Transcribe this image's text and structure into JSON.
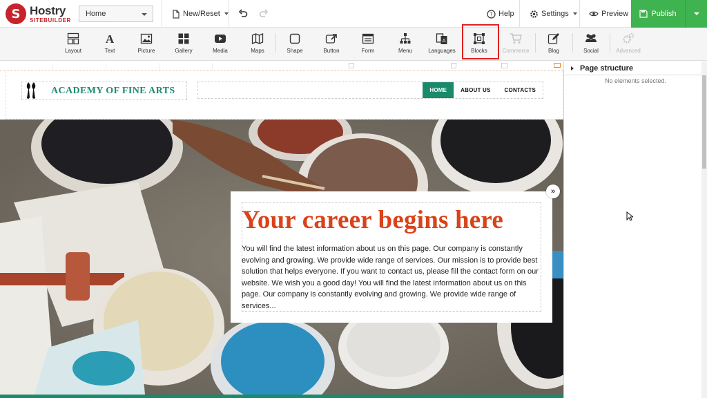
{
  "app": {
    "logo_main": "Hostry",
    "logo_sub": "SITEBUILDER",
    "page_select": "Home",
    "new_reset": "New/Reset",
    "help": "Help",
    "settings": "Settings",
    "preview": "Preview",
    "publish": "Publish"
  },
  "toolbar": {
    "tools": [
      {
        "label": "Layout",
        "icon": "layout-icon"
      },
      {
        "label": "Text",
        "icon": "text-icon"
      },
      {
        "label": "Picture",
        "icon": "picture-icon"
      },
      {
        "label": "Gallery",
        "icon": "gallery-icon"
      },
      {
        "label": "Media",
        "icon": "media-icon"
      },
      {
        "label": "Maps",
        "icon": "maps-icon"
      },
      {
        "label": "Shape",
        "icon": "shape-icon"
      },
      {
        "label": "Button",
        "icon": "button-icon"
      },
      {
        "label": "Form",
        "icon": "form-icon"
      },
      {
        "label": "Menu",
        "icon": "menu-icon"
      },
      {
        "label": "Languages",
        "icon": "languages-icon"
      },
      {
        "label": "Blocks",
        "icon": "blocks-icon",
        "highlighted": true
      },
      {
        "label": "Commerce",
        "icon": "commerce-icon",
        "disabled": true
      },
      {
        "label": "Blog",
        "icon": "blog-icon"
      },
      {
        "label": "Social",
        "icon": "social-icon"
      },
      {
        "label": "Advanced",
        "icon": "advanced-icon",
        "disabled": true
      }
    ]
  },
  "site": {
    "brand": "ACADEMY OF FINE ARTS",
    "nav": [
      "HOME",
      "ABOUT US",
      "CONTACTS"
    ],
    "hero_title": "Your career begins here",
    "hero_text": "You will find the latest information about us on this page. Our company is constantly evolving and growing. We provide wide range of services. Our mission is to provide best solution that helps everyone. If you want to contact us, please fill the contact form on our website. We wish you a good day! You will find the latest information about us on this page. Our company is constantly evolving and growing. We provide wide range of services..."
  },
  "panel": {
    "title": "Page structure",
    "empty": "No elements selected."
  },
  "colors": {
    "brand_red": "#c8232c",
    "publish_green": "#3fb34f",
    "site_teal": "#1a8a6b",
    "hero_title": "#d9431a",
    "highlight": "#e0211f"
  }
}
